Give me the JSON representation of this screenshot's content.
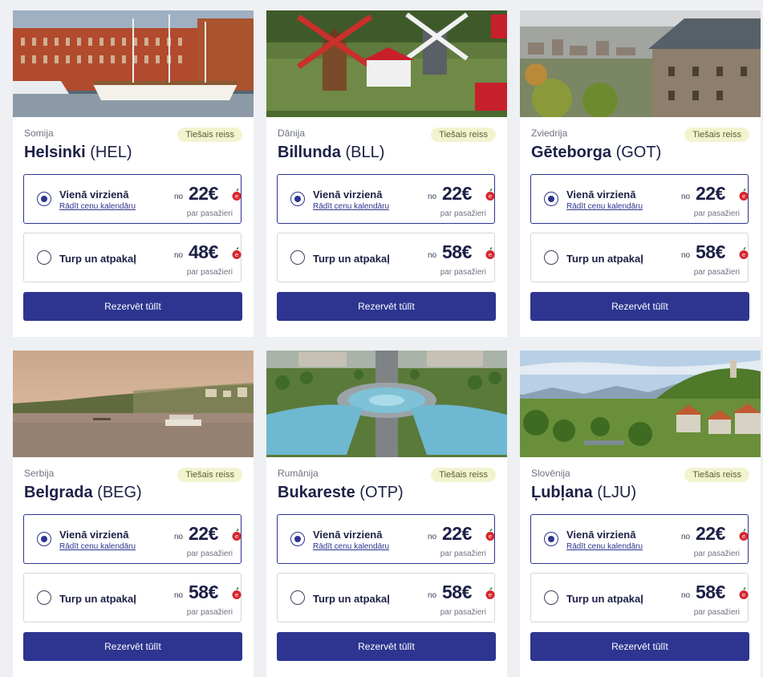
{
  "badge_text": "Tiešais reiss",
  "one_way_label": "Vienā virzienā",
  "calendar_link": "Rādīt cenu kalendāru",
  "round_trip_label": "Turp un atpakaļ",
  "from_label": "no",
  "per_passenger": "par pasažieri",
  "book_button": "Rezervēt tūlīt",
  "colors": {
    "primary": "#2d3590",
    "badge_bg": "#f2f4cf",
    "price_icon": "#d7262e"
  },
  "cards": [
    {
      "country": "Somija",
      "city": "Helsinki",
      "code": "(HEL)",
      "one_way_price": "22€",
      "round_trip_price": "48€",
      "image": "helsinki-harbour-photo"
    },
    {
      "country": "Dānija",
      "city": "Billunda",
      "code": "(BLL)",
      "one_way_price": "22€",
      "round_trip_price": "58€",
      "image": "billund-lego-windmills-photo"
    },
    {
      "country": "Zviedrija",
      "city": "Gēteborga",
      "code": "(GOT)",
      "one_way_price": "22€",
      "round_trip_price": "58€",
      "image": "gothenburg-skyline-photo"
    },
    {
      "country": "Serbija",
      "city": "Belgrada",
      "code": "(BEG)",
      "one_way_price": "22€",
      "round_trip_price": "58€",
      "image": "belgrade-river-photo"
    },
    {
      "country": "Rumānija",
      "city": "Bukareste",
      "code": "(OTP)",
      "one_way_price": "22€",
      "round_trip_price": "58€",
      "image": "bucharest-fountains-photo"
    },
    {
      "country": "Slovēnija",
      "city": "Ļubļana",
      "code": "(LJU)",
      "one_way_price": "22€",
      "round_trip_price": "58€",
      "image": "ljubljana-castle-photo"
    }
  ]
}
